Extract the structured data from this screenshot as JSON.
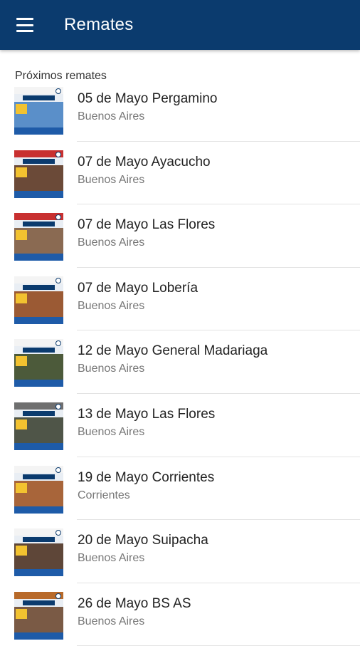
{
  "appbar": {
    "title": "Remates",
    "menu_icon": "menu-icon"
  },
  "section": {
    "title": "Próximos remates"
  },
  "items": [
    {
      "title": "05 de Mayo Pergamino",
      "subtitle": "Buenos Aires",
      "photo_color": "#5a8fc9",
      "top_color": "#f4f4f4"
    },
    {
      "title": "07 de Mayo Ayacucho",
      "subtitle": "Buenos Aires",
      "photo_color": "#6b4a38",
      "top_color": "#c83030"
    },
    {
      "title": "07 de Mayo Las Flores",
      "subtitle": "Buenos Aires",
      "photo_color": "#8a6a52",
      "top_color": "#c83030"
    },
    {
      "title": "07 de Mayo Lobería",
      "subtitle": "Buenos Aires",
      "photo_color": "#9b5a34",
      "top_color": "#f4f4f4"
    },
    {
      "title": "12 de Mayo General Madariaga",
      "subtitle": "Buenos Aires",
      "photo_color": "#4c5a3a",
      "top_color": "#f4f4f4"
    },
    {
      "title": "13 de Mayo Las Flores",
      "subtitle": "Buenos Aires",
      "photo_color": "#4f5548",
      "top_color": "#6f6f6f"
    },
    {
      "title": "19 de Mayo Corrientes",
      "subtitle": "Corrientes",
      "photo_color": "#a8653a",
      "top_color": "#f4f4f4"
    },
    {
      "title": "20 de Mayo Suipacha",
      "subtitle": "Buenos Aires",
      "photo_color": "#5e4638",
      "top_color": "#f4f4f4"
    },
    {
      "title": "26 de Mayo BS AS",
      "subtitle": "Buenos Aires",
      "photo_color": "#7a5a45",
      "top_color": "#b86a2a"
    }
  ],
  "colors": {
    "appbar": "#0b3b6e",
    "accent_band": "#1e5ba8"
  }
}
